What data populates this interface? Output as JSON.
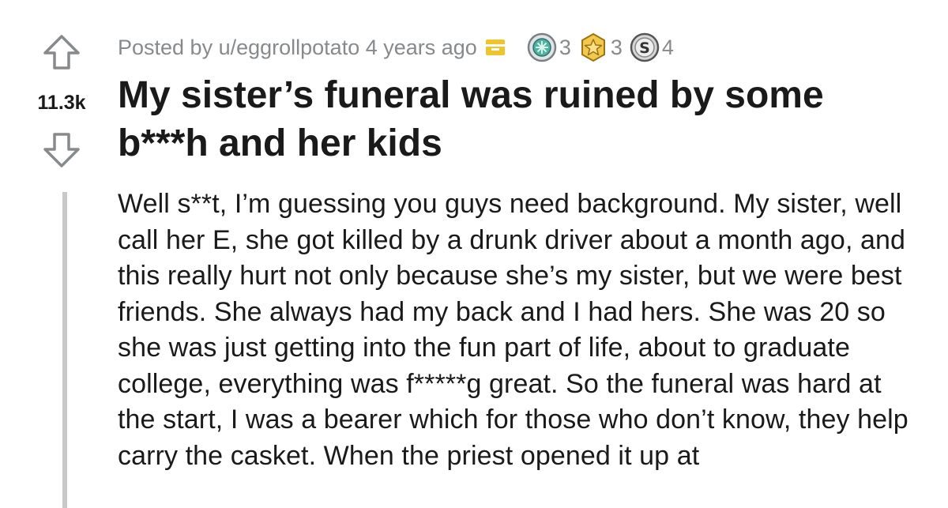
{
  "post": {
    "score": "11.3k",
    "posted_by": "Posted by u/eggrollpotato 4 years ago",
    "awards": [
      {
        "icon": "helpful-award-icon",
        "count": "3",
        "color": "#4fb3a0"
      },
      {
        "icon": "gold-star-award-icon",
        "count": "3",
        "color": "#e6b52e"
      },
      {
        "icon": "silver-s-award-icon",
        "count": "4",
        "color": "#9a9a9a"
      }
    ],
    "title": "My sister’s funeral was ruined by some b***h and her kids",
    "body": "Well s**t, I’m guessing you guys need background. My sister, well call her E, she got killed by a drunk driver about a month ago, and this really hurt not only because she’s my sister, but we were best friends. She always had my back and I had hers. She was 20 so she was just getting into the fun part of life, about to graduate college, everything was f*****g great. So the funeral was hard at the start, I was a bearer which for those who don’t know, they help carry the casket. When the priest opened it up at"
  },
  "colors": {
    "meta_text": "#878a8c",
    "text": "#1a1a1b",
    "thread_line": "#c8c8c8",
    "save_icon": "#f0c52b"
  }
}
